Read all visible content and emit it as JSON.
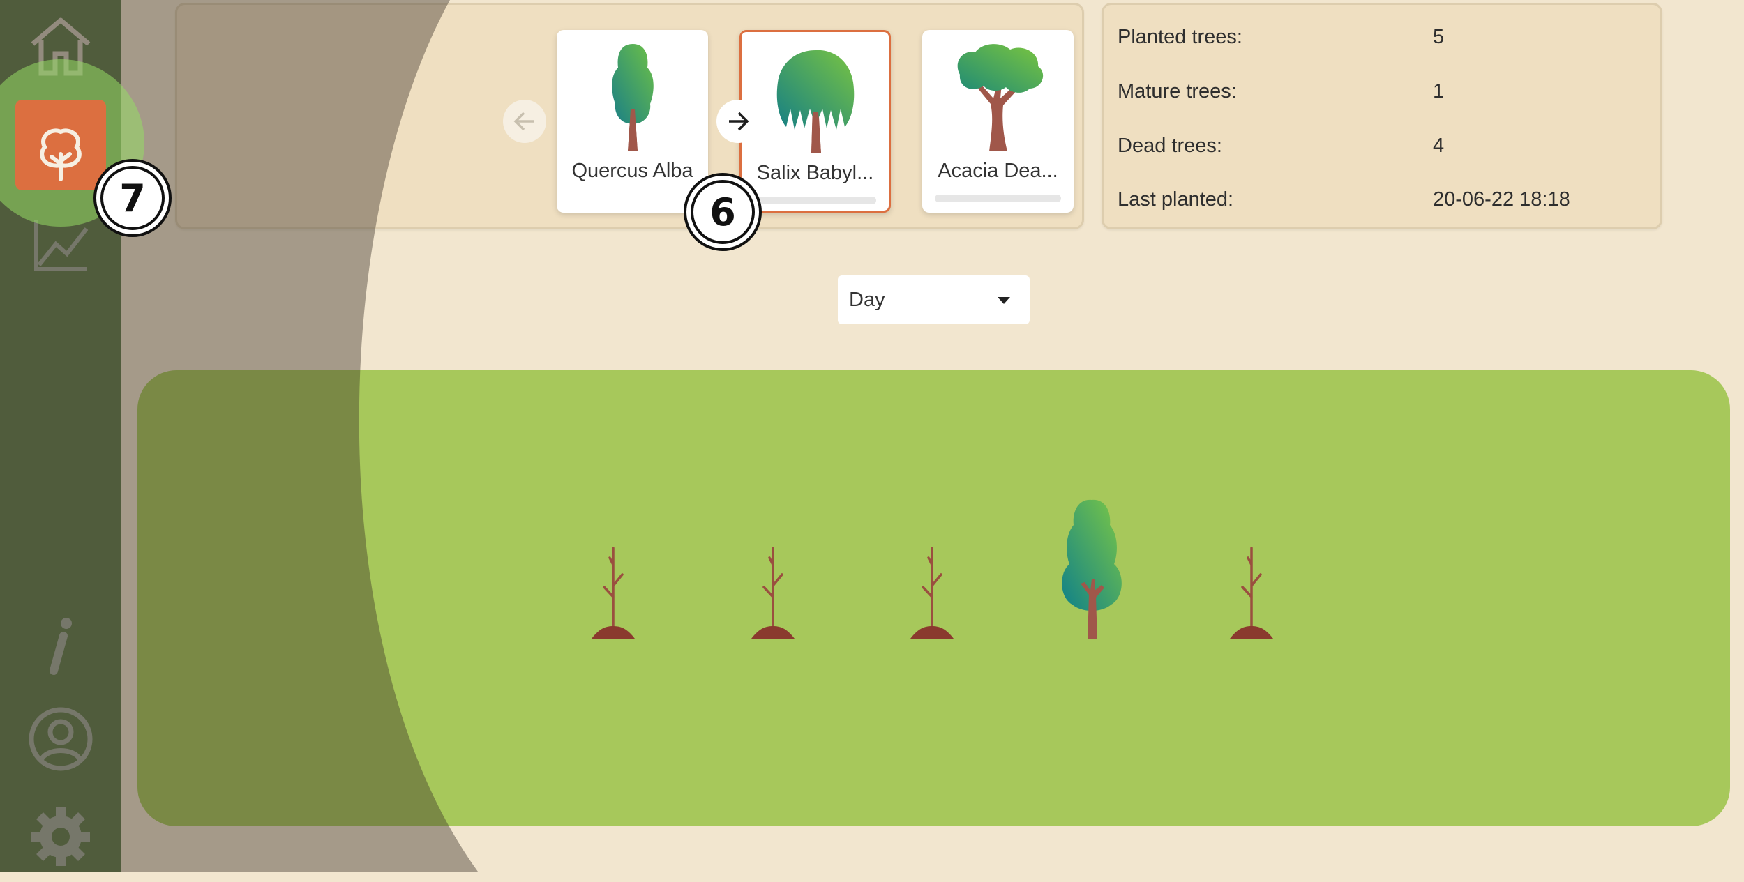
{
  "sidebar": {
    "items": [
      {
        "name": "home",
        "icon": "home-icon",
        "active": false
      },
      {
        "name": "trees",
        "icon": "tree-icon",
        "active": true
      },
      {
        "name": "statistics",
        "icon": "chart-icon",
        "active": false
      },
      {
        "name": "info",
        "icon": "info-icon",
        "active": false
      },
      {
        "name": "profile",
        "icon": "user-icon",
        "active": false
      },
      {
        "name": "settings",
        "icon": "gear-icon",
        "active": false
      }
    ]
  },
  "tree_selector": {
    "cards": [
      {
        "label": "Quercus Alba"
      },
      {
        "label": "Salix Babyl..."
      },
      {
        "label": "Acacia Dea..."
      }
    ],
    "prev_icon": "arrow-left-icon",
    "next_icon": "arrow-right-icon"
  },
  "stats": {
    "planted_label": "Planted trees:",
    "planted_value": "5",
    "mature_label": "Mature trees:",
    "mature_value": "1",
    "dead_label": "Dead trees:",
    "dead_value": "4",
    "last_label": "Last planted:",
    "last_value": "20-06-22 18:18"
  },
  "period_select": {
    "value": "Day"
  },
  "garden": {
    "plants": [
      "dead-sapling",
      "dead-sapling",
      "dead-sapling",
      "mature-tree",
      "dead-sapling"
    ]
  },
  "annotations": {
    "badge_6": "6",
    "badge_7": "7"
  },
  "colors": {
    "sidebar": "#5f7a4b",
    "accent": "#dc6f40",
    "panel": "#efdfc1",
    "garden": "#a7c85b",
    "background": "#f2e6cf"
  }
}
